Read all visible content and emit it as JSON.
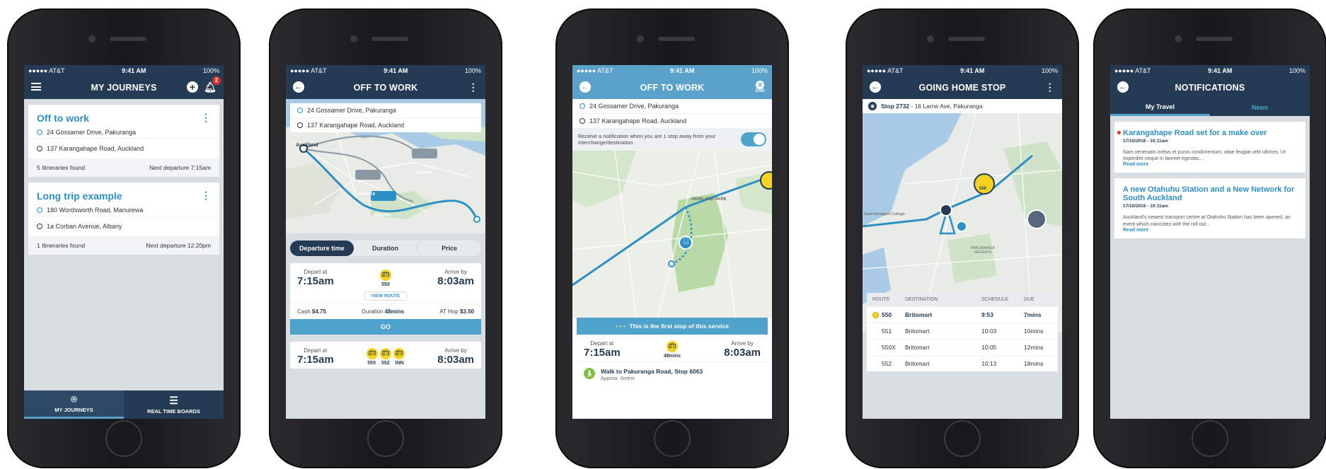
{
  "status": {
    "carrier": "●●●●● AT&T",
    "time": "9:41 AM",
    "battery": "100%"
  },
  "screen1": {
    "title": "MY JOURNEYS",
    "badge": "2",
    "journeys": [
      {
        "name": "Off to work",
        "from": "24 Gossamer Drive, Pakuranga",
        "to": "137 Karangahape Road, Auckland",
        "itineraries": "5 Itineraries found",
        "next": "Next departure 7:15am"
      },
      {
        "name": "Long trip example",
        "from": "180 Wordsworth Road, Manurewa",
        "to": "1a Corban Avenue, Albany",
        "itineraries": "1 Itineraries found",
        "next": "Next departure 12:20pm"
      }
    ],
    "tabs": [
      {
        "label": "MY JOURNEYS",
        "icon": "map-pin-icon"
      },
      {
        "label": "REAL TIME BOARDS",
        "icon": "list-icon"
      }
    ]
  },
  "screen2": {
    "title": "OFF TO WORK",
    "from": "24 Gossamer Drive, Pakuranga",
    "to": "137 Karangahape Road, Auckland",
    "map_labels": {
      "place": "Auckland",
      "a": "+7mins",
      "b": "+9mins",
      "c": "48mins"
    },
    "sort": [
      "Departure time",
      "Duration",
      "Price"
    ],
    "trip1": {
      "depart_label": "Depart at",
      "depart": "7:15am",
      "arrive_label": "Arrive by",
      "arrive": "8:03am",
      "routes": [
        "550"
      ],
      "view_route": "VIEW ROUTE",
      "cash": "Cash",
      "cash_val": "$4.75",
      "duration": "Duration",
      "duration_val": "48mins",
      "athop": "AT Hop",
      "athop_val": "$3.50",
      "go": "GO"
    },
    "trip2": {
      "depart_label": "Depart at",
      "depart": "7:15am",
      "arrive_label": "Arrive by",
      "arrive": "8:03am",
      "routes": [
        "550",
        "552",
        "INN"
      ]
    }
  },
  "screen3": {
    "title": "OFF TO WORK",
    "end": "END",
    "from": "24 Gossamer Drive, Pakuranga",
    "to": "137 Karangahape Road, Auckland",
    "notify_text": "Recieve a notification when you are 1 stop away from your interchange/destination",
    "map_labels": {
      "park": "HIGHLAND PARK"
    },
    "first_stop": "This is the first stop of this service",
    "trip": {
      "depart_label": "Depart at",
      "depart": "7:15am",
      "duration": "48mins",
      "arrive_label": "Arrive by",
      "arrive": "8:03am"
    },
    "walk": {
      "title": "Walk to Pakuranga Road, Stop 6063",
      "sub": "Approx. 6mins"
    }
  },
  "screen4": {
    "title": "GOING HOME STOP",
    "stop_id": "Stop 2732",
    "stop_addr": " - 16 Larne Ave, Pakuranga",
    "map_labels": {
      "bus": "550",
      "college": "Saint Kentigern College",
      "heights": "PAKURANGA HEIGHTS"
    },
    "columns": [
      "ROUTE",
      "DESTINATION",
      "SCHEDULE",
      "DUE"
    ],
    "rows": [
      {
        "route": "550",
        "dest": "Britomart",
        "sched": "9:53",
        "due": "7mins"
      },
      {
        "route": "551",
        "dest": "Britomart",
        "sched": "10:03",
        "due": "10mins"
      },
      {
        "route": "550X",
        "dest": "Britomart",
        "sched": "10:05",
        "due": "12mins"
      },
      {
        "route": "552",
        "dest": "Britomart",
        "sched": "10:13",
        "due": "18mins"
      }
    ]
  },
  "screen5": {
    "title": "NOTIFICATIONS",
    "tabs": [
      "My Travel",
      "News"
    ],
    "items": [
      {
        "title": "Karangahape Road set for a make over",
        "date": "17/10/2016 - 10:11am",
        "body": "Nam venenatis metus et purus condimentum, vitae feugiat velit ultrices. Ut imperdiet neque in laoreet egestas...",
        "more": "Read more"
      },
      {
        "title": "A new Otahuhu Station and a New Network for South Auckland",
        "date": "17/10/2016 - 10:11am",
        "body": "Auckland's newest transport centre at Otahuhu Station has been opened, an event which coincides with the roll-out...",
        "more": "Read more"
      }
    ]
  },
  "colors": {
    "navy": "#243b53",
    "accent": "#2d90c5",
    "light_header": "#5aa2c9",
    "bus_yellow": "#f5d31e",
    "alert_red": "#e52d2d",
    "walk_green": "#7ac143"
  }
}
